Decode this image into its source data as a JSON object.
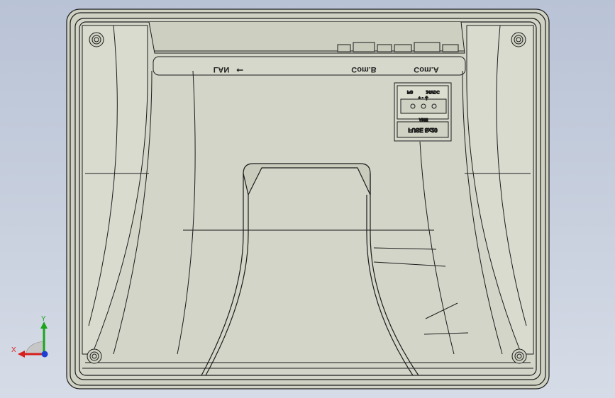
{
  "colors": {
    "background_top": "#b9c3d6",
    "background_bottom": "#d6dce7",
    "body_fill": "#cfd1c3",
    "body_stroke": "#1c1c1c",
    "axis_x": "#d81e1e",
    "axis_y": "#1aa51a",
    "axis_z": "#1e3fd0"
  },
  "model": {
    "ports": {
      "lan": "LAN",
      "usb_symbol": "⭠",
      "com_b": "Com.B",
      "com_a": "Com.A"
    },
    "power_block": {
      "voltage": "24VDC",
      "fg": "FG",
      "pins": "+  -  ⏚",
      "terminal_id": "AB55",
      "fuse": "FUSE 5x20"
    }
  },
  "triad": {
    "x_label": "X",
    "y_label": "Y",
    "z_icon": "z-axis-dot-icon"
  }
}
